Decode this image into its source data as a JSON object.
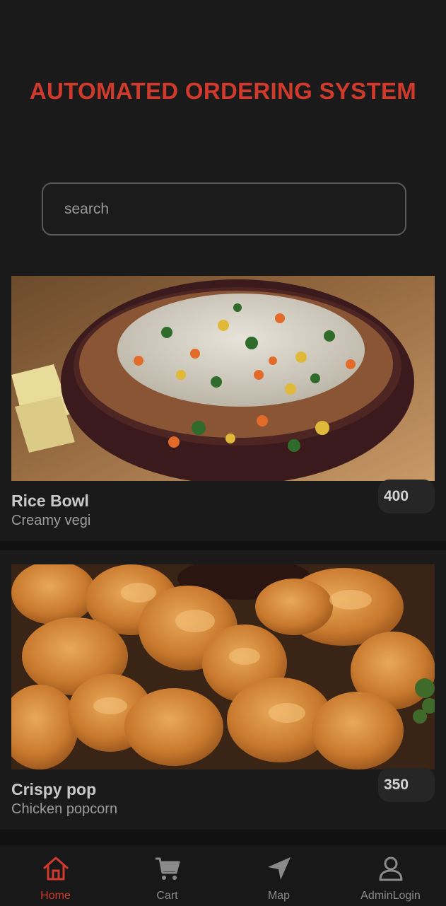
{
  "header": {
    "title": "AUTOMATED ORDERING SYSTEM",
    "search_placeholder": "search"
  },
  "items": [
    {
      "name": "Rice Bowl",
      "description": "Creamy vegi",
      "price": "400"
    },
    {
      "name": "Crispy pop",
      "description": "Chicken popcorn",
      "price": "350"
    }
  ],
  "nav": {
    "home": "Home",
    "cart": "Cart",
    "map": "Map",
    "admin": "AdminLogin"
  },
  "colors": {
    "accent": "#d03a2c",
    "background": "#111111",
    "surface": "#1a1a1a"
  },
  "icons": {
    "home": "home-icon",
    "cart": "cart-icon",
    "map": "navigation-arrow-icon",
    "admin": "user-icon"
  }
}
